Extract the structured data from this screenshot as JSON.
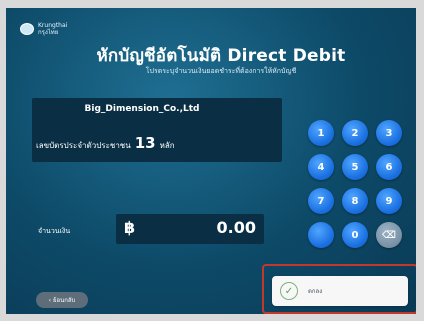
{
  "header": {
    "logo_text": "Krungthai",
    "logo_subtext": "กรุงไทย",
    "title": "หักบัญชีอัตโนมัติ Direct Debit",
    "subtitle": "โปรดระบุจำนวนเงินยอดชำระที่ต้องการให้หักบัญชี"
  },
  "info": {
    "company": "Big_Dimension_Co.,Ltd",
    "instruction_prefix": "เลขบัตรประจำตัวประชาชน",
    "digit_count": "13",
    "instruction_suffix": "หลัก"
  },
  "amount": {
    "label": "จำนวนเงิน",
    "currency": "฿",
    "value": "0.00"
  },
  "keypad": {
    "keys": [
      "1",
      "2",
      "3",
      "4",
      "5",
      "6",
      "7",
      "8",
      "9",
      "",
      "0",
      "⌫"
    ]
  },
  "footer": {
    "back_label": "ย้อนกลับ",
    "confirm_label": "ตกลง"
  }
}
